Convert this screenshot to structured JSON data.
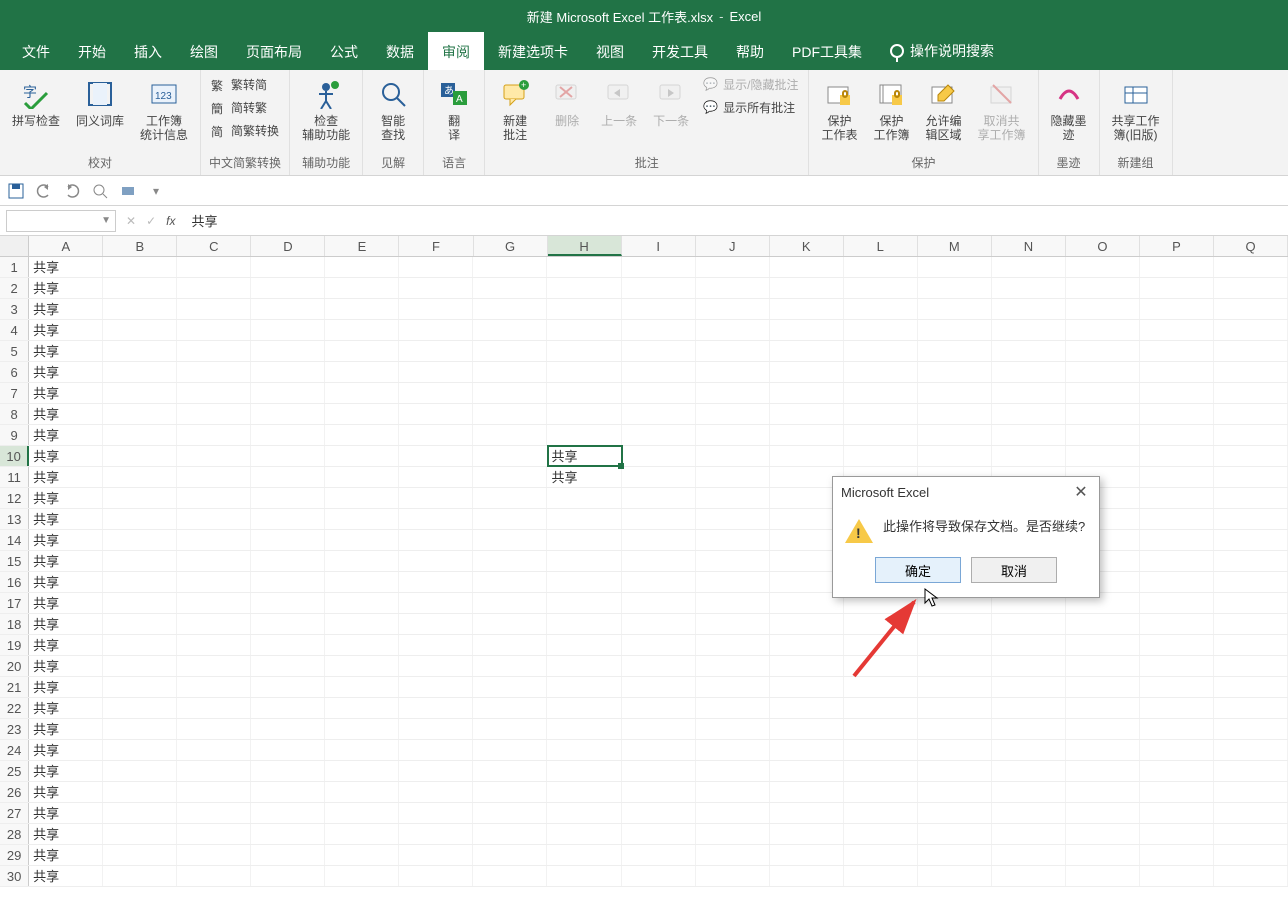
{
  "titlebar": {
    "filename": "新建 Microsoft Excel 工作表.xlsx",
    "app": "Excel"
  },
  "tabs": [
    "文件",
    "开始",
    "插入",
    "绘图",
    "页面布局",
    "公式",
    "数据",
    "审阅",
    "新建选项卡",
    "视图",
    "开发工具",
    "帮助",
    "PDF工具集"
  ],
  "active_tab_index": 7,
  "tell_me": "操作说明搜索",
  "ribbon_groups": {
    "proofing": {
      "label": "校对",
      "spelling": "拼写检查",
      "thesaurus": "同义词库",
      "stats": "工作簿\n统计信息"
    },
    "chinese": {
      "label": "中文简繁转换",
      "to_simp": "繁转简",
      "to_trad": "简转繁",
      "convert": "简繁转换"
    },
    "accessibility": {
      "label": "辅助功能",
      "check": "检查\n辅助功能"
    },
    "insights": {
      "label": "见解",
      "smart": "智能\n查找"
    },
    "language": {
      "label": "语言",
      "translate": "翻\n译"
    },
    "comments": {
      "label": "批注",
      "new": "新建\n批注",
      "delete": "删除",
      "prev": "上一条",
      "next": "下一条",
      "showhide": "显示/隐藏批注",
      "showall": "显示所有批注"
    },
    "protect": {
      "label": "保护",
      "sheet": "保护\n工作表",
      "workbook": "保护\n工作簿",
      "allowedit": "允许编\n辑区域",
      "unshare": "取消共\n享工作簿"
    },
    "ink": {
      "label": "墨迹",
      "hide": "隐藏墨\n迹"
    },
    "newgroup": {
      "label": "新建组",
      "share": "共享工作\n簿(旧版)"
    }
  },
  "formula_bar": {
    "name_box": "",
    "formula": "共享"
  },
  "columns": [
    "A",
    "B",
    "C",
    "D",
    "E",
    "F",
    "G",
    "H",
    "I",
    "J",
    "K",
    "L",
    "M",
    "N",
    "O",
    "P",
    "Q"
  ],
  "active_cell": {
    "row": 10,
    "col": "H"
  },
  "row_count": 30,
  "cells": {
    "A1": "共享",
    "A2": "共享",
    "A3": "共享",
    "A4": "共享",
    "A5": "共享",
    "A6": "共享",
    "A7": "共享",
    "A8": "共享",
    "A9": "共享",
    "A10": "共享",
    "A11": "共享",
    "A12": "共享",
    "A13": "共享",
    "A14": "共享",
    "A15": "共享",
    "A16": "共享",
    "A17": "共享",
    "A18": "共享",
    "A19": "共享",
    "A20": "共享",
    "A21": "共享",
    "A22": "共享",
    "A23": "共享",
    "A24": "共享",
    "A25": "共享",
    "A26": "共享",
    "A27": "共享",
    "A28": "共享",
    "A29": "共享",
    "A30": "共享",
    "H10": "共享",
    "H11": "共享"
  },
  "dialog": {
    "title": "Microsoft Excel",
    "message": "此操作将导致保存文档。是否继续?",
    "ok": "确定",
    "cancel": "取消"
  }
}
